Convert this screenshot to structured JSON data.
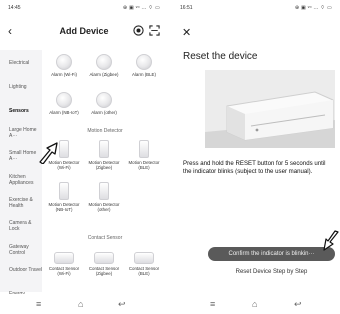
{
  "left": {
    "status": {
      "time": "14:45",
      "icons": "⊕ ▣ ᵛᵒ ... ⌔ ▭"
    },
    "header": {
      "back": "‹",
      "title": "Add Device"
    },
    "sidebar": [
      {
        "label": "Electrical",
        "active": false
      },
      {
        "label": "Lighting",
        "active": false
      },
      {
        "label": "Sensors",
        "active": true
      },
      {
        "label": "Large Home A···",
        "active": false
      },
      {
        "label": "Small Home A···",
        "active": false
      },
      {
        "label": "Kitchen Appliances",
        "active": false
      },
      {
        "label": "Exercise & Health",
        "active": false
      },
      {
        "label": "Camera & Lock",
        "active": false
      },
      {
        "label": "Gateway Control",
        "active": false
      },
      {
        "label": "Outdoor Travel",
        "active": false
      },
      {
        "label": "Energy",
        "active": false
      }
    ],
    "sections": {
      "motion": "Motion Detector",
      "contact": "Contact Sensor"
    },
    "devices": [
      {
        "label": "Alarm (Wi-Fi)"
      },
      {
        "label": "Alarm (Zigbee)"
      },
      {
        "label": "Alarm (BLE)"
      },
      {
        "label": "Alarm (NB-IoT)"
      },
      {
        "label": "Alarm (other)"
      },
      {
        "label": "Motion Detector (Wi-Fi)"
      },
      {
        "label": "Motion Detector (Zigbee)"
      },
      {
        "label": "Motion Detector (BLE)"
      },
      {
        "label": "Motion Detector (NB-IoT)"
      },
      {
        "label": "Motion Detector (other)"
      },
      {
        "label": "Contact Sensor (Wi-Fi)"
      },
      {
        "label": "Contact Sensor (Zigbee)"
      },
      {
        "label": "Contact Sensor (BLE)"
      }
    ],
    "nav": {
      "menu": "≡",
      "home": "⌂",
      "back": "↩"
    }
  },
  "right": {
    "status": {
      "time": "16:51",
      "icons": "⊕ ▣ ᵛᵒ ... ⌔ ▭"
    },
    "close": "✕",
    "title": "Reset the device",
    "instruction": "Press and hold the RESET button for 5 seconds until the indicator blinks (subject to the user manual).",
    "confirm_button": "Confirm the indicator is blinkin···",
    "reset_link": "Reset Device Step by Step",
    "nav": {
      "menu": "≡",
      "home": "⌂",
      "back": "↩"
    }
  },
  "colors": {
    "button_bg": "#5a5a5a",
    "sidebar_bg": "#f4f4f6"
  }
}
